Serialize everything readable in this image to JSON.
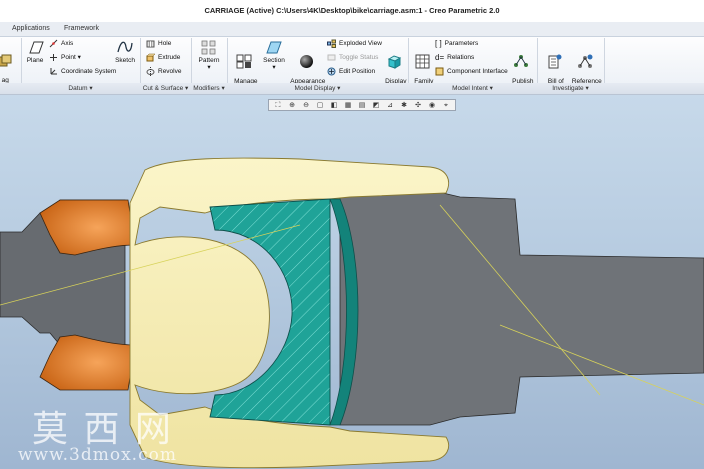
{
  "window": {
    "title": "CARRIAGE (Active) C:\\Users\\4K\\Desktop\\bike\\carriage.asm:1 - Creo Parametric 2.0"
  },
  "tabs": [
    "Applications",
    "Framework"
  ],
  "ribbon": {
    "components_partial": "ag\nonents",
    "plane": "Plane",
    "axis": "Axis",
    "point": "Point",
    "coord_sys": "Coordinate System",
    "sketch": "Sketch",
    "hole": "Hole",
    "extrude": "Extrude",
    "revolve": "Revolve",
    "pattern": "Pattern",
    "manage_views": "Manage\nViews",
    "section": "Section",
    "appearance_gallery": "Appearance\nGallery",
    "exploded_view": "Exploded View",
    "toggle_status": "Toggle Status",
    "edit_position": "Edit Position",
    "display_style": "Display\nStyle",
    "family_table": "Family\nTable",
    "parameters": "Parameters",
    "relations": "Relations",
    "component_interface": "Component Interface",
    "publish_geometry": "Publish\nGeometry",
    "bill_of_materials": "Bill of\nMaterials",
    "reference_viewer": "Reference\nViewer"
  },
  "groups": {
    "datum": "Datum ▾",
    "cut_surface": "Cut & Surface ▾",
    "modifiers": "Modifiers ▾",
    "model_display": "Model Display ▾",
    "model_intent": "Model Intent ▾",
    "investigate": "Investigate ▾"
  },
  "watermark": {
    "cn": "莫 西 网",
    "url": "www.3dmox.com"
  },
  "colors": {
    "accent": "#2f6fb6",
    "body": "#6a6e72",
    "fitting": "#f8f1b8",
    "teal": "#1fa398",
    "orange": "#e07a1d"
  }
}
